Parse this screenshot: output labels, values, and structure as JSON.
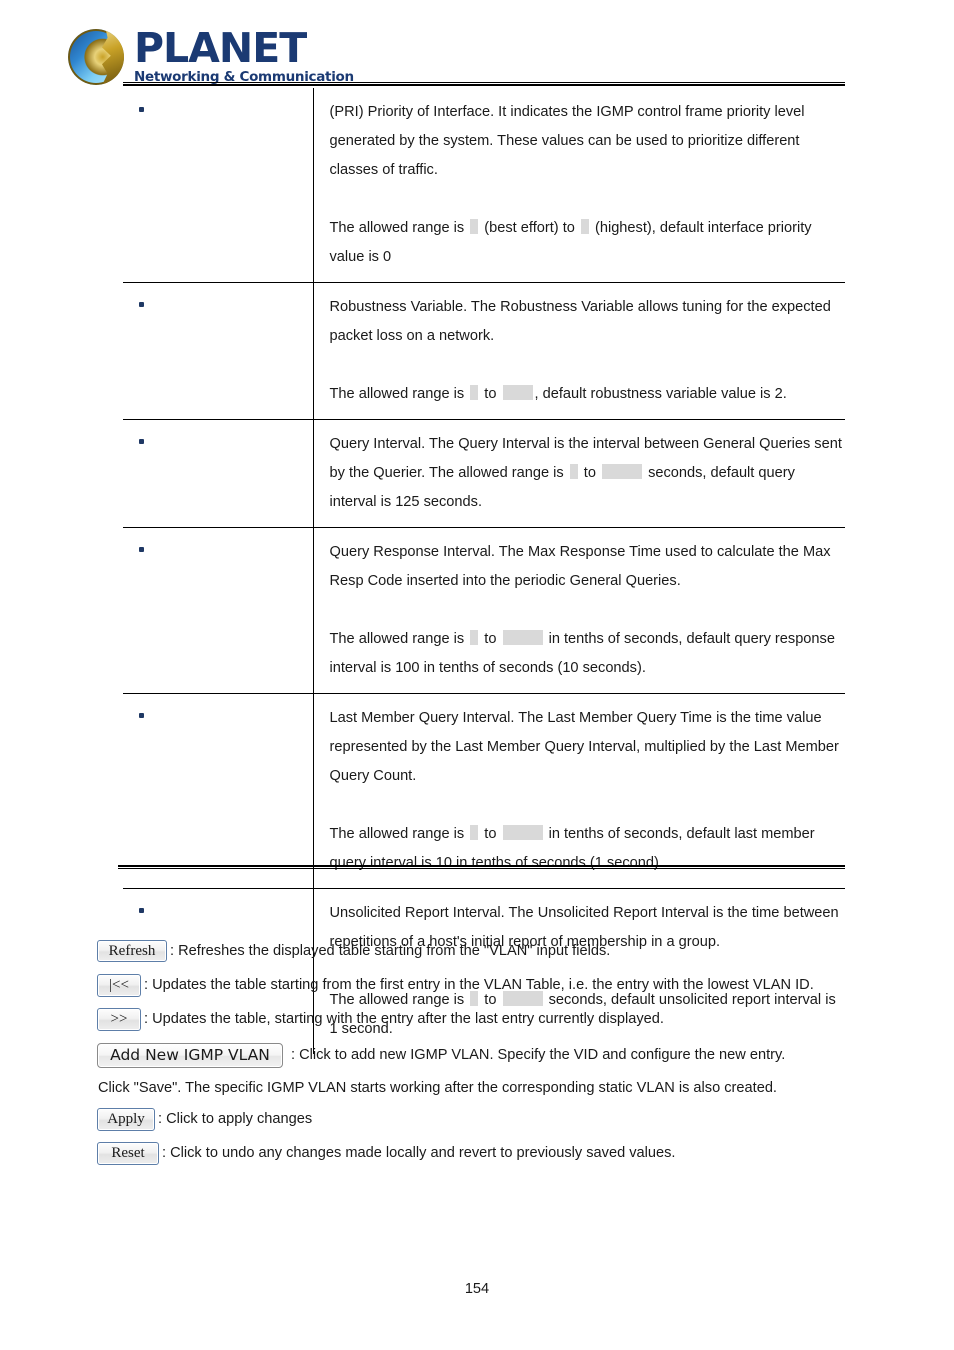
{
  "brand": {
    "name": "PLANET",
    "tagline": "Networking & Communication",
    "logo_icon": "planet-globe-icon",
    "brand_color": "#1b3a73"
  },
  "table": {
    "placeholder_color": "#d9d9d9",
    "rows": [
      {
        "bullet": "•",
        "paragraphs": [
          {
            "segments": [
              {
                "type": "text",
                "text": "(PRI) Priority of Interface. It indicates the IGMP control frame priority level generated by the system. These values can be used to prioritize different classes of traffic."
              }
            ]
          },
          {
            "segments": [
              {
                "type": "text",
                "text": "The allowed range is "
              },
              {
                "type": "blank",
                "size": "xs"
              },
              {
                "type": "text",
                "text": " (best effort) to "
              },
              {
                "type": "blank",
                "size": "xs"
              },
              {
                "type": "text",
                "text": " (highest), default interface priority value is 0"
              }
            ]
          }
        ]
      },
      {
        "bullet": "•",
        "paragraphs": [
          {
            "segments": [
              {
                "type": "text",
                "text": "Robustness Variable. The Robustness Variable allows tuning for the expected packet loss on a network."
              }
            ]
          },
          {
            "segments": [
              {
                "type": "text",
                "text": "The allowed range is "
              },
              {
                "type": "blank",
                "size": "xs"
              },
              {
                "type": "text",
                "text": " to "
              },
              {
                "type": "blank",
                "size": "s"
              },
              {
                "type": "text",
                "text": ", default robustness variable value is 2."
              }
            ]
          }
        ]
      },
      {
        "bullet": "•",
        "paragraphs": [
          {
            "segments": [
              {
                "type": "text",
                "text": "Query Interval. The Query Interval is the interval between General Queries sent by the Querier. The allowed range is "
              },
              {
                "type": "blank",
                "size": "xs"
              },
              {
                "type": "text",
                "text": " to "
              },
              {
                "type": "blank",
                "size": "m"
              },
              {
                "type": "text",
                "text": " seconds, default query interval is 125 seconds."
              }
            ]
          }
        ]
      },
      {
        "bullet": "•",
        "paragraphs": [
          {
            "segments": [
              {
                "type": "text",
                "text": "Query Response Interval. The Max Response Time used to calculate the Max Resp Code inserted into the periodic General Queries."
              }
            ]
          },
          {
            "segments": [
              {
                "type": "text",
                "text": "The allowed range is "
              },
              {
                "type": "blank",
                "size": "xs"
              },
              {
                "type": "text",
                "text": " to "
              },
              {
                "type": "blank",
                "size": "m"
              },
              {
                "type": "text",
                "text": " in tenths of seconds, default query response interval is 100 in tenths of seconds (10 seconds)."
              }
            ]
          }
        ]
      },
      {
        "bullet": "•",
        "paragraphs": [
          {
            "segments": [
              {
                "type": "text",
                "text": "Last Member Query Interval. The Last Member Query Time is the time value represented by the Last Member Query Interval, multiplied by the Last Member Query Count."
              }
            ]
          },
          {
            "segments": [
              {
                "type": "text",
                "text": "The allowed range is "
              },
              {
                "type": "blank",
                "size": "xs"
              },
              {
                "type": "text",
                "text": " to "
              },
              {
                "type": "blank",
                "size": "m"
              },
              {
                "type": "text",
                "text": " in tenths of seconds, default last member query interval is 10 in tenths of seconds (1 second)."
              }
            ]
          }
        ]
      },
      {
        "bullet": "•",
        "paragraphs": [
          {
            "segments": [
              {
                "type": "text",
                "text": "Unsolicited Report Interval. The Unsolicited Report Interval is the time between repetitions of a host's initial report of membership in a group."
              }
            ]
          },
          {
            "segments": [
              {
                "type": "text",
                "text": "The allowed range is "
              },
              {
                "type": "blank",
                "size": "xs"
              },
              {
                "type": "text",
                "text": " to "
              },
              {
                "type": "blank",
                "size": "m"
              },
              {
                "type": "text",
                "text": " seconds, default unsolicited report interval is 1 second."
              }
            ]
          }
        ]
      }
    ]
  },
  "buttons": {
    "refresh": {
      "label": "Refresh",
      "description": ": Refreshes the displayed table starting from the \"VLAN\" input fields."
    },
    "first": {
      "label": "|<<",
      "description": ": Updates the table starting from the first entry in the VLAN Table, i.e. the entry with the lowest VLAN ID."
    },
    "next": {
      "label": ">>",
      "description": ": Updates the table, starting with the entry after the last entry currently displayed."
    },
    "add_new_igmp_vlan": {
      "label": "Add New IGMP VLAN",
      "description": ": Click to add new IGMP VLAN. Specify the VID and configure the new entry."
    },
    "apply": {
      "label": "Apply",
      "description": ": Click to apply changes"
    },
    "reset": {
      "label": "Reset",
      "description": ": Click to undo any changes made locally and revert to previously saved values."
    }
  },
  "save_note": "Click \"Save\". The specific IGMP VLAN starts working after the corresponding static VLAN is also created.",
  "page_number": "154"
}
